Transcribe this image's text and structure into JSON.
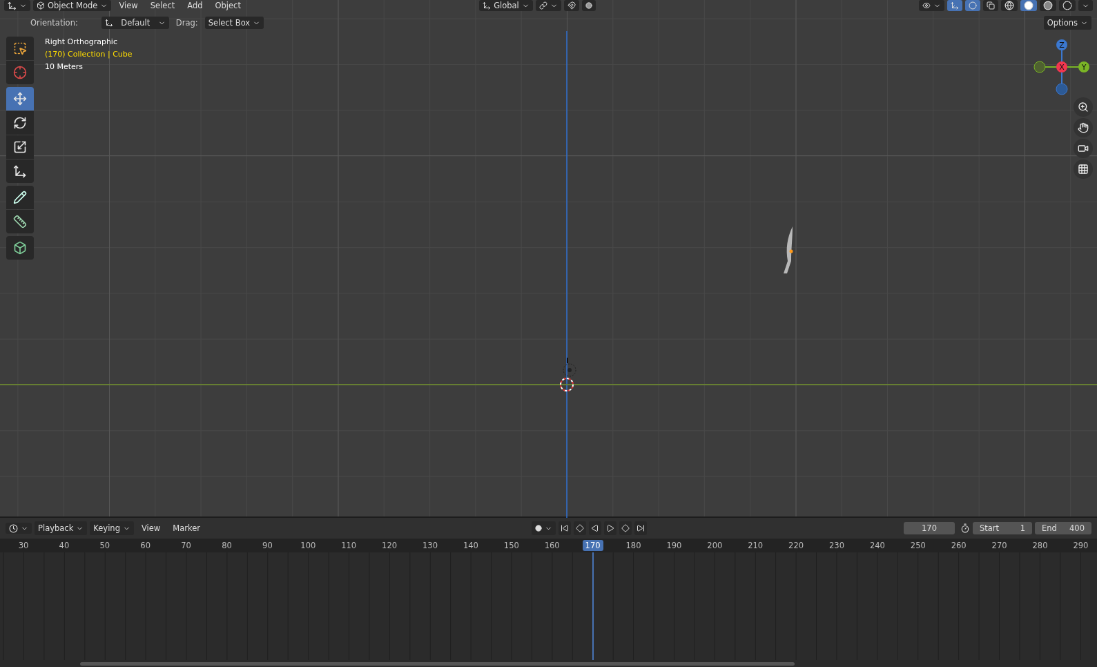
{
  "header": {
    "mode": "Object Mode",
    "menus": [
      "View",
      "Select",
      "Add",
      "Object"
    ],
    "transform_orientation": "Global"
  },
  "toggles": {
    "snap": false,
    "proportional": false,
    "gizmos": true,
    "overlays": true,
    "xray": false
  },
  "shading": [
    {
      "kind": "wireframe",
      "selected": false
    },
    {
      "kind": "solid",
      "selected": true
    },
    {
      "kind": "material",
      "selected": false
    },
    {
      "kind": "rendered",
      "selected": false
    }
  ],
  "tool_settings": {
    "orientation_label": "Orientation:",
    "orientation": "Default",
    "drag_label": "Drag:",
    "drag": "Select Box",
    "options": "Options"
  },
  "toolbar": [
    [
      {
        "kind": "select",
        "selected": false
      },
      {
        "kind": "cursor",
        "selected": false
      }
    ],
    [
      {
        "kind": "move",
        "selected": true
      },
      {
        "kind": "rotate",
        "selected": false
      },
      {
        "kind": "scale",
        "selected": false
      },
      {
        "kind": "transform",
        "selected": false
      }
    ],
    [
      {
        "kind": "annotate",
        "selected": false
      },
      {
        "kind": "measure",
        "selected": false
      }
    ],
    [
      {
        "kind": "add_cube",
        "selected": false
      }
    ]
  ],
  "viewport_info": {
    "view": "Right Orthographic",
    "collection": "(170) Collection | Cube",
    "scale": "10 Meters"
  },
  "gizmo": {
    "z": "Z",
    "x": "X",
    "y": "Y"
  },
  "timeline": {
    "menus": [
      "Playback",
      "Keying",
      "View",
      "Marker"
    ],
    "current_frame": "170",
    "start_label": "Start",
    "start": "1",
    "end_label": "End",
    "end": "400",
    "ticks": [
      {
        "label": "30",
        "selected": false
      },
      {
        "label": "40",
        "selected": false
      },
      {
        "label": "50",
        "selected": false
      },
      {
        "label": "60",
        "selected": false
      },
      {
        "label": "70",
        "selected": false
      },
      {
        "label": "80",
        "selected": false
      },
      {
        "label": "90",
        "selected": false
      },
      {
        "label": "100",
        "selected": false
      },
      {
        "label": "110",
        "selected": false
      },
      {
        "label": "120",
        "selected": false
      },
      {
        "label": "130",
        "selected": false
      },
      {
        "label": "140",
        "selected": false
      },
      {
        "label": "150",
        "selected": false
      },
      {
        "label": "160",
        "selected": false
      },
      {
        "label": "170",
        "selected": true
      },
      {
        "label": "180",
        "selected": false
      },
      {
        "label": "190",
        "selected": false
      },
      {
        "label": "200",
        "selected": false
      },
      {
        "label": "210",
        "selected": false
      },
      {
        "label": "220",
        "selected": false
      },
      {
        "label": "230",
        "selected": false
      },
      {
        "label": "240",
        "selected": false
      },
      {
        "label": "250",
        "selected": false
      },
      {
        "label": "260",
        "selected": false
      },
      {
        "label": "270",
        "selected": false
      },
      {
        "label": "280",
        "selected": false
      },
      {
        "label": "290",
        "selected": false
      }
    ]
  }
}
